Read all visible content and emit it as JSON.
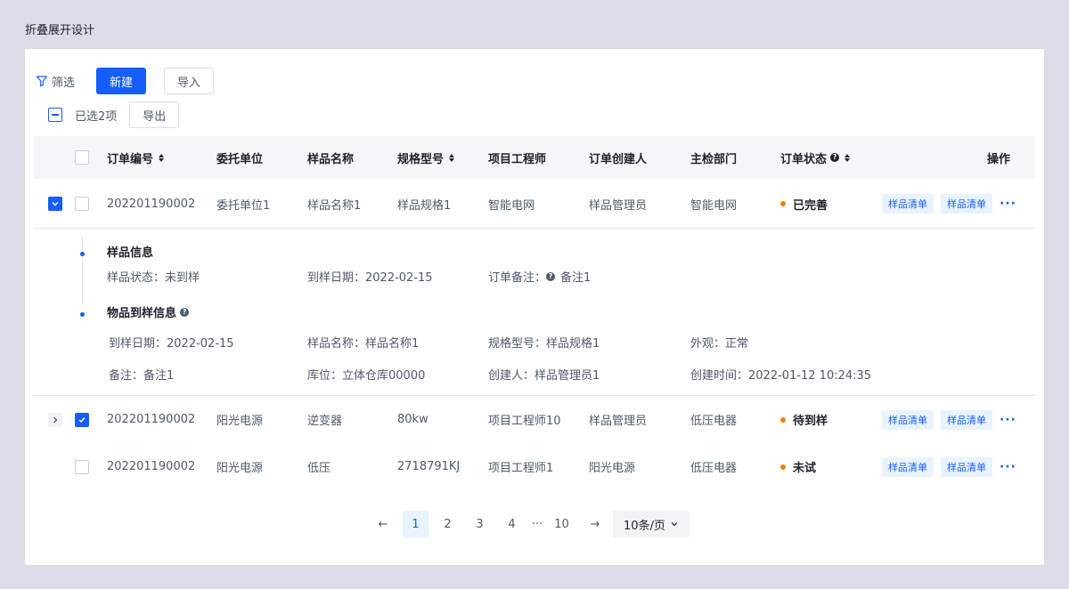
{
  "page_title": "折叠展开设计",
  "toolbar": {
    "filter_label": "筛选",
    "new_label": "新建",
    "import_label": "导入",
    "selected_text": "已选2项",
    "export_label": "导出"
  },
  "table": {
    "headers": {
      "order_no": "订单编号",
      "client": "委托单位",
      "sample_name": "样品名称",
      "spec": "规格型号",
      "engineer": "项目工程师",
      "creator": "订单创建人",
      "dept": "主检部门",
      "status": "订单状态",
      "action": "操作"
    },
    "rows": [
      {
        "order_no": "202201190002",
        "client": "委托单位1",
        "sample_name": "样品名称1",
        "spec": "样品规格1",
        "engineer": "智能电网",
        "creator": "样品管理员",
        "dept": "智能电网",
        "status": "已完善",
        "tag1": "样品清单",
        "tag2": "样品清单",
        "more": "···"
      },
      {
        "order_no": "202201190002",
        "client": "阳光电源",
        "sample_name": "逆变器",
        "spec": "80kw",
        "engineer": "项目工程师10",
        "creator": "样品管理员",
        "dept": "低压电器",
        "status": "待到样",
        "tag1": "样品清单",
        "tag2": "样品清单",
        "more": "···"
      },
      {
        "order_no": "202201190002",
        "client": "阳光电源",
        "sample_name": "低压",
        "spec": "2718791KJ",
        "engineer": "项目工程师1",
        "creator": "阳光电源",
        "dept": "低压电器",
        "status": "未试",
        "tag1": "样品清单",
        "tag2": "样品清单",
        "more": "···"
      }
    ]
  },
  "detail": {
    "sample_info": {
      "title": "样品信息",
      "status": "样品状态：未到样",
      "arrival_date": "到样日期：2022-02-15",
      "remark_label": "订单备注：",
      "remark_value": "备注1"
    },
    "arrival_info": {
      "title": "物品到样信息",
      "arrival_date": "到样日期：2022-02-15",
      "sample_name": "样品名称：样品名称1",
      "spec": "规格型号：样品规格1",
      "appearance": "外观：正常",
      "remark": "备注：备注1",
      "location": "库位：立体仓库00000",
      "creator": "创建人：样品管理员1",
      "created_at": "创建时间：2022-01-12 10:24:35"
    }
  },
  "pagination": {
    "prev": "←",
    "pages": [
      "1",
      "2",
      "3",
      "4"
    ],
    "ellipsis": "···",
    "last": "10",
    "next": "→",
    "page_size": "10条/页",
    "current": "1"
  },
  "colors": {
    "primary": "#165DFF",
    "status_dot": "#FF7D00",
    "background": "#DCDCE6"
  }
}
